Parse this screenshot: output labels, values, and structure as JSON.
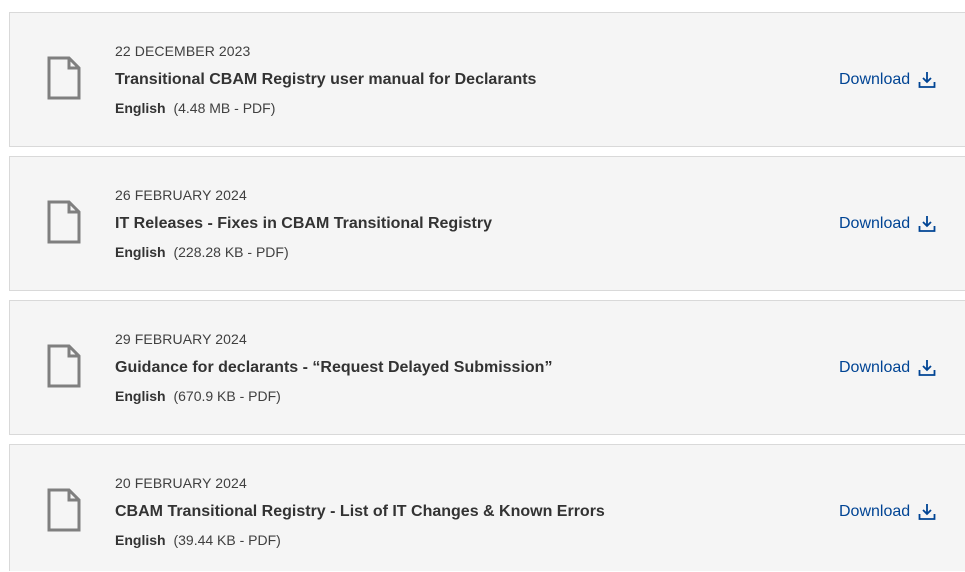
{
  "documents": [
    {
      "date": "22 DECEMBER 2023",
      "title": "Transitional CBAM Registry user manual for Declarants",
      "language": "English",
      "size": "(4.48 MB - PDF)",
      "download_label": "Download",
      "file_icon": "file-icon",
      "download_icon": "download-icon"
    },
    {
      "date": "26 FEBRUARY 2024",
      "title": "IT Releases - Fixes in CBAM Transitional Registry",
      "language": "English",
      "size": "(228.28 KB - PDF)",
      "download_label": "Download",
      "file_icon": "file-icon",
      "download_icon": "download-icon"
    },
    {
      "date": "29 FEBRUARY 2024",
      "title": "Guidance for declarants - “Request Delayed Submission”",
      "language": "English",
      "size": "(670.9 KB - PDF)",
      "download_label": "Download",
      "file_icon": "file-icon",
      "download_icon": "download-icon"
    },
    {
      "date": "20 FEBRUARY 2024",
      "title": "CBAM Transitional Registry - List of IT Changes & Known Errors",
      "language": "English",
      "size": "(39.44 KB - PDF)",
      "download_label": "Download",
      "file_icon": "file-icon",
      "download_icon": "download-icon"
    }
  ],
  "colors": {
    "card_background": "#f5f5f5",
    "card_border": "#d9d9d9",
    "link": "#004494",
    "text": "#404040",
    "title": "#333333",
    "icon": "#7f7f7f"
  }
}
